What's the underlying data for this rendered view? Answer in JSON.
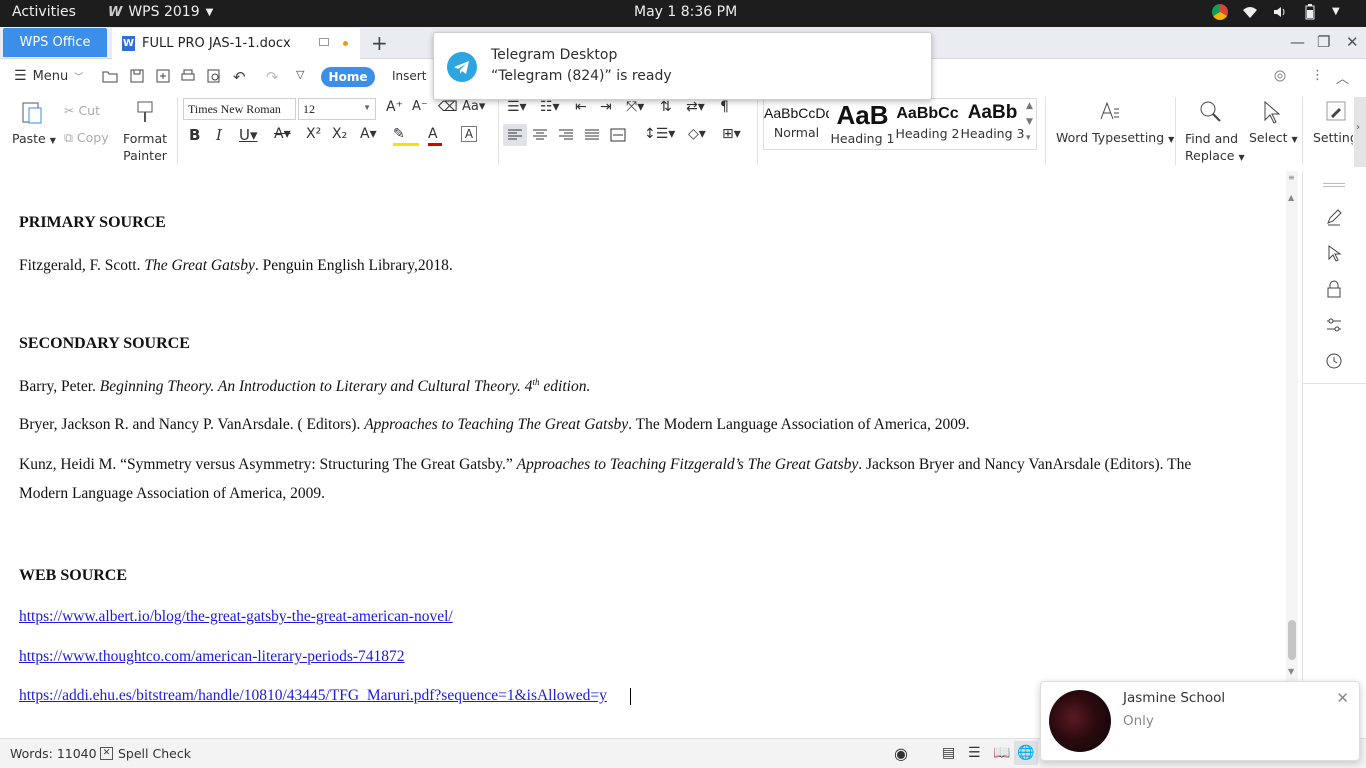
{
  "topbar": {
    "activities": "Activities",
    "app_name": "WPS 2019",
    "clock": "May 1   8:36 PM"
  },
  "tabs": {
    "wps_office": "WPS Office",
    "document": "FULL PRO JAS-1-1.docx",
    "add": "+"
  },
  "toolbar": {
    "menu_label": "Menu",
    "home_tab": "Home",
    "insert_tab": "Insert"
  },
  "ribbon": {
    "paste": "Paste",
    "cut": "Cut",
    "copy": "Copy",
    "format_painter_1": "Format",
    "format_painter_2": "Painter",
    "font_name": "Times New Roman",
    "font_size": "12",
    "styles": [
      {
        "preview": "AaBbCcDd",
        "name": "Normal"
      },
      {
        "preview": "AaB",
        "name": "Heading 1"
      },
      {
        "preview": "AaBbCc",
        "name": "Heading 2"
      },
      {
        "preview": "AaBb",
        "name": "Heading 3"
      }
    ],
    "word_typesetting": "Word Typesetting",
    "find_replace_1": "Find and",
    "find_replace_2": "Replace",
    "select": "Select",
    "settings": "Setting"
  },
  "document": {
    "primary_heading": "PRIMARY SOURCE",
    "primary_1_a": "Fitzgerald, F. Scott. ",
    "primary_1_i": "The Great Gatsby",
    "primary_1_b": ". Penguin English Library,2018.",
    "secondary_heading": "SECONDARY SOURCE",
    "sec_1_a": "Barry, Peter. ",
    "sec_1_i": "Beginning Theory. An Introduction to Literary and Cultural Theory. 4",
    "sec_1_sup": "th",
    "sec_1_i2": " edition.",
    "sec_2_a": "Bryer, Jackson R. and Nancy P. VanArsdale. ( Editors). ",
    "sec_2_i": "Approaches to Teaching The Great Gatsby",
    "sec_2_b": ". The Modern Language Association of America, 2009.",
    "sec_3_a": "Kunz, Heidi M. “Symmetry versus Asymmetry: Structuring The Great Gatsby.” ",
    "sec_3_i": "Approaches to Teaching Fitzgerald’s The Great Gatsby",
    "sec_3_b": ". Jackson Bryer and Nancy VanArsdale (Editors). The",
    "sec_3_c": "Modern Language  Association of America, 2009.",
    "web_heading": "WEB SOURCE",
    "web_1": "https://www.albert.io/blog/the-great-gatsby-the-great-american-novel/",
    "web_2": "https://www.thoughtco.com/american-literary-periods-741872",
    "web_3": "https://addi.ehu.es/bitstream/handle/10810/43445/TFG_Maruri.pdf?sequence=1&isAllowed=y"
  },
  "status": {
    "words": "Words: 11040",
    "spell_check": "Spell Check"
  },
  "notifications": {
    "telegram_title": "Telegram Desktop",
    "telegram_body": "“Telegram (824)” is ready",
    "chat_name": "Jasmine School",
    "chat_message": "Only"
  },
  "colors": {
    "accent": "#3b8eea",
    "link": "#1b1be0",
    "topbar": "#1d1d1d",
    "telegram": "#2ca5e0"
  }
}
